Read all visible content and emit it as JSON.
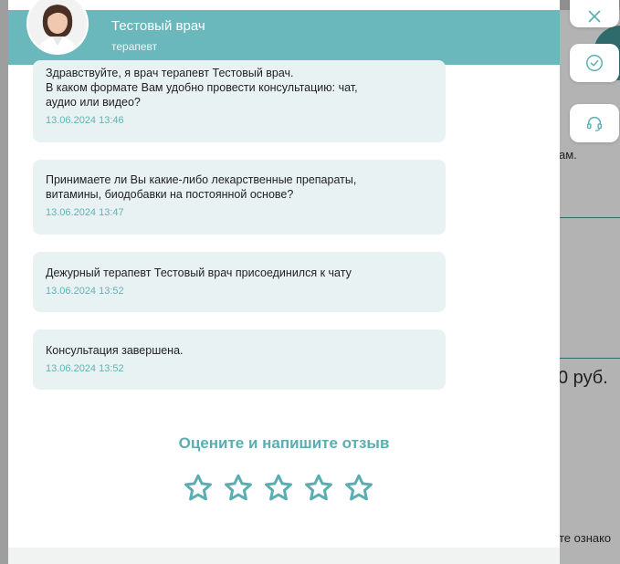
{
  "doctor": {
    "name": "Тестовый врач",
    "role": "терапевт"
  },
  "messages": [
    {
      "text": "Здравствуйте, я врач терапевт Тестовый врач.\nВ каком формате Вам удобно провести консультацию: чат,\nаудио или видео?",
      "time": "13.06.2024 13:46"
    },
    {
      "text": "Принимаете ли Вы какие-либо лекарственные препараты,\nвитамины, биодобавки на постоянной основе?",
      "time": "13.06.2024 13:47"
    },
    {
      "text": "Дежурный терапевт Тестовый врач присоединился к чату",
      "time": "13.06.2024 13:52"
    },
    {
      "text": "Консультация завершена.",
      "time": "13.06.2024 13:52"
    }
  ],
  "rating": {
    "title": "Оцените и напишите отзыв",
    "stars": 5,
    "value": 0
  },
  "background": {
    "text_am": "ам.",
    "price": "0 руб.",
    "bottom_text": "те ознако"
  },
  "colors": {
    "accent": "#6ab8bc",
    "bubble": "#e9f2f2",
    "timestamp": "#5fb3b7"
  }
}
